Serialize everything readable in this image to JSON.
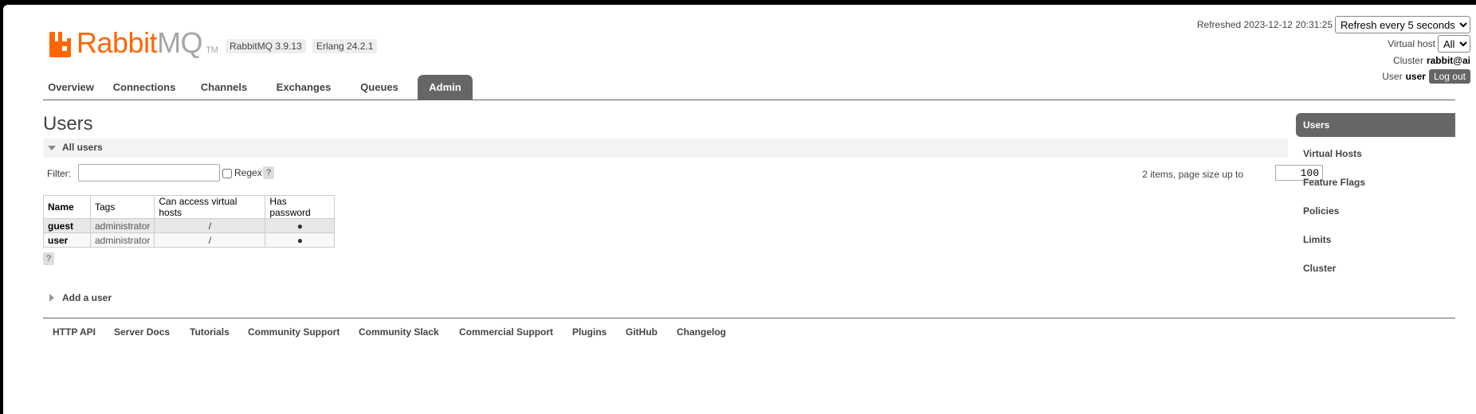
{
  "header": {
    "logo_rabbit": "Rabbit",
    "logo_mq": "MQ",
    "logo_tm": "TM",
    "rabbitmq_version": "RabbitMQ 3.9.13",
    "erlang_version": "Erlang 24.2.1"
  },
  "status": {
    "refreshed_label": "Refreshed 2023-12-12 20:31:25",
    "refresh_selected": "Refresh every 5 seconds",
    "virtual_host_label": "Virtual host",
    "virtual_host_selected": "All",
    "cluster_label": "Cluster",
    "cluster_name": "rabbit@ai",
    "user_label": "User",
    "user_name": "user",
    "logout_label": "Log out"
  },
  "tabs": [
    {
      "label": "Overview"
    },
    {
      "label": "Connections"
    },
    {
      "label": "Channels"
    },
    {
      "label": "Exchanges"
    },
    {
      "label": "Queues"
    },
    {
      "label": "Admin",
      "active": true
    }
  ],
  "main": {
    "title": "Users",
    "section_title": "All users",
    "filter_label": "Filter:",
    "filter_value": "",
    "regex_label": "Regex",
    "help_label": "?",
    "page_info": "2 items, page size up to",
    "page_size": "100",
    "table": {
      "columns": [
        "Name",
        "Tags",
        "Can access virtual hosts",
        "Has password"
      ],
      "rows": [
        {
          "name": "guest",
          "tags": "administrator",
          "vhosts": "/",
          "has_password": "●"
        },
        {
          "name": "user",
          "tags": "administrator",
          "vhosts": "/",
          "has_password": "●"
        }
      ]
    },
    "add_user_label": "Add a user"
  },
  "sidebar": {
    "items": [
      {
        "label": "Users",
        "active": true
      },
      {
        "label": "Virtual Hosts"
      },
      {
        "label": "Feature Flags"
      },
      {
        "label": "Policies"
      },
      {
        "label": "Limits"
      },
      {
        "label": "Cluster"
      }
    ]
  },
  "footer": {
    "links": [
      "HTTP API",
      "Server Docs",
      "Tutorials",
      "Community Support",
      "Community Slack",
      "Commercial Support",
      "Plugins",
      "GitHub",
      "Changelog"
    ]
  },
  "colors": {
    "brand_orange": "#ff6600",
    "tab_active": "#666666"
  }
}
